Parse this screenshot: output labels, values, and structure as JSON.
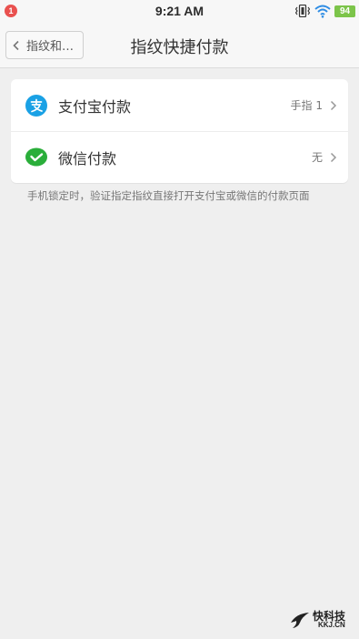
{
  "status_bar": {
    "notification_count": "1",
    "time": "9:21 AM",
    "battery_level": "94",
    "icons": [
      "vibrate-icon",
      "wifi-icon",
      "battery-icon"
    ]
  },
  "title_bar": {
    "back_label": "指纹和…",
    "title": "指纹快捷付款"
  },
  "payment_options": [
    {
      "label": "支付宝付款",
      "value": "手指 1",
      "icon": "alipay-icon",
      "icon_color": "#1aa1e5"
    },
    {
      "label": "微信付款",
      "value": "无",
      "icon": "wechat-pay-icon",
      "icon_color": "#2aae3a"
    }
  ],
  "description": "手机锁定时，验证指定指纹直接打开支付宝或微信的付款页面",
  "watermark": {
    "name": "快科技",
    "domain": "KKJ.CN"
  }
}
